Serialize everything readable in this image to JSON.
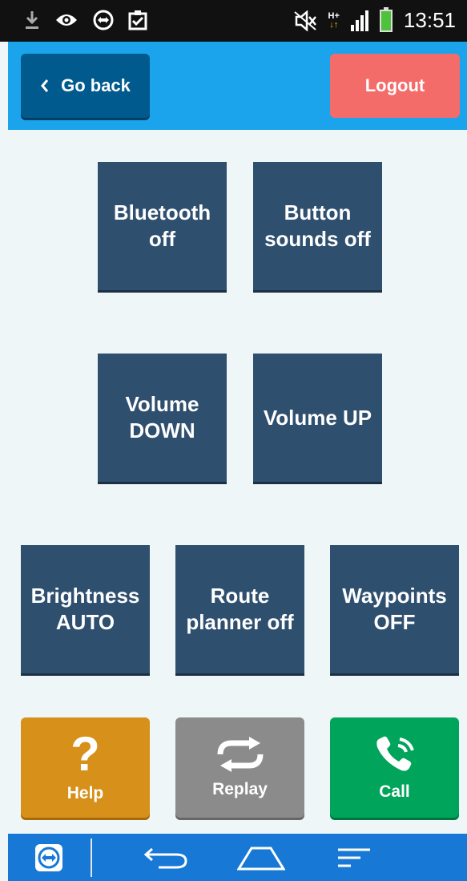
{
  "status_bar": {
    "clock": "13:51",
    "network_label": "H+",
    "icons": [
      "download-icon",
      "eye-icon",
      "teamviewer-icon",
      "clipboard-icon",
      "mute-icon",
      "signal-icon",
      "battery-icon"
    ]
  },
  "header": {
    "back_label": "Go back",
    "logout_label": "Logout"
  },
  "tiles": [
    {
      "label": "Bluetooth\noff"
    },
    {
      "label": "Button\nsounds off"
    },
    {
      "label": "Volume\nDOWN"
    },
    {
      "label": "Volume UP"
    },
    {
      "label": "Brightness\nAUTO"
    },
    {
      "label": "Route\nplanner off"
    },
    {
      "label": "Waypoints\nOFF"
    }
  ],
  "actions": {
    "help_label": "Help",
    "replay_label": "Replay",
    "call_label": "Call"
  },
  "colors": {
    "header": "#1ba3eb",
    "back_button": "#005a8e",
    "logout_button": "#f36c6a",
    "tile": "#2f4f6f",
    "help": "#d7901a",
    "replay": "#8b8b8b",
    "call": "#00a45a",
    "nav_bar": "#1778d6"
  }
}
